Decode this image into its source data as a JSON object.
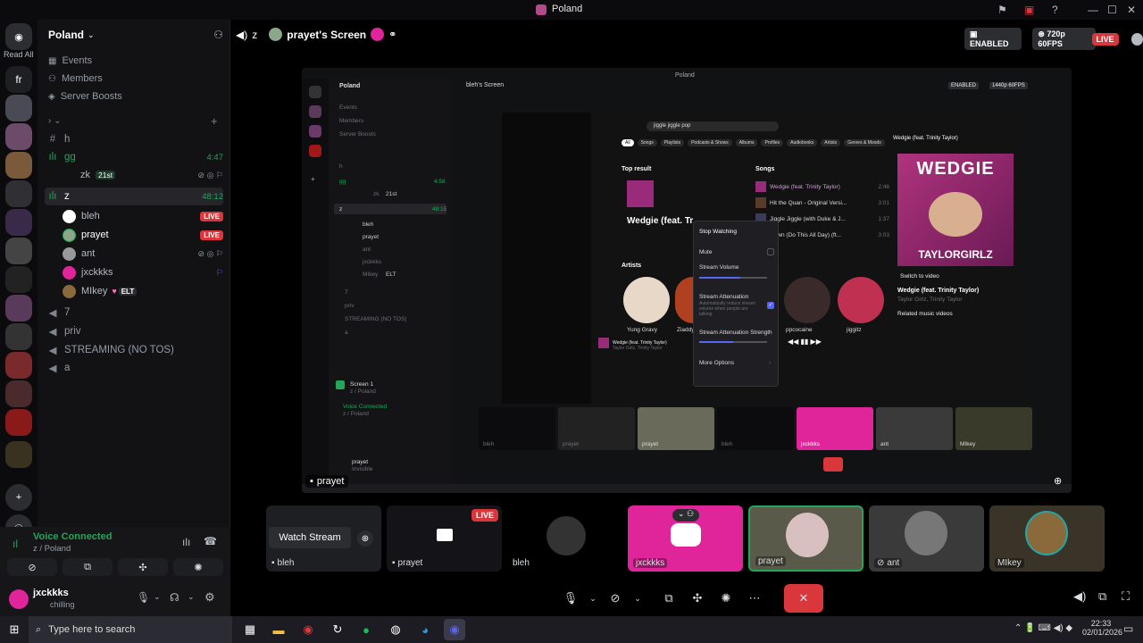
{
  "window": {
    "title": "Poland"
  },
  "rail": {
    "read_all": "Read All",
    "fr": "fr"
  },
  "server": {
    "name": "Poland"
  },
  "channels": {
    "nav": [
      "Events",
      "Members",
      "Server Boosts"
    ],
    "h": "h",
    "gg": {
      "name": "gg",
      "time": "4:47",
      "user": "zk",
      "badge": "21st"
    },
    "z": {
      "name": "z",
      "time": "48:12",
      "users": [
        {
          "name": "bleh",
          "live": "LIVE"
        },
        {
          "name": "prayet",
          "live": "LIVE"
        },
        {
          "name": "ant",
          "live": ""
        },
        {
          "name": "jxckkks",
          "live": ""
        },
        {
          "name": "MIkey",
          "tag": "ELT",
          "live": ""
        }
      ]
    },
    "others": [
      "7",
      "priv",
      "STREAMING (NO TOS)",
      "a"
    ]
  },
  "voice": {
    "status": "Voice Connected",
    "sub": "z / Poland"
  },
  "me": {
    "name": "jxckkks",
    "status": "chilling"
  },
  "topbar": {
    "channel": "z",
    "screen_title": "prayet's Screen",
    "enabled": "ENABLED",
    "quality": "720p 60FPS",
    "live": "LIVE"
  },
  "inner": {
    "title": "Poland",
    "server": "Poland",
    "screen": "bleh's Screen",
    "enabled": "ENABLED",
    "quality": "1440p 60FPS",
    "nav": [
      "Events",
      "Members",
      "Server Boosts"
    ],
    "channels": [
      "h",
      "gg",
      "z"
    ],
    "gg_time": "4:58",
    "gg_user": "zk",
    "gg_badge": "21st",
    "z_time": "48:15",
    "users": [
      "bleh",
      "prayet",
      "ant",
      "jxckkks",
      "MIkey"
    ],
    "tag": "ELT",
    "others": [
      "7",
      "priv",
      "STREAMING (NO TOS)",
      "a"
    ],
    "screen_panel": "Screen 1",
    "screen_panel_sub": "z / Poland",
    "voice": "Voice Connected",
    "voice_sub": "z / Poland",
    "me": "prayet",
    "me_status": "Invisible",
    "tiles": [
      "bleh",
      "prayet",
      "prayet",
      "bleh",
      "jxckkks",
      "ant",
      "MIkey"
    ]
  },
  "spotify": {
    "search": "jiggle jiggle pop",
    "filters": [
      "All",
      "Songs",
      "Playlists",
      "Podcasts & Shows",
      "Albums",
      "Profiles",
      "Audiobooks",
      "Artists",
      "Genres & Moods"
    ],
    "top_result": "Top result",
    "top_title": "Wedgie (feat. Tr",
    "songs_header": "Songs",
    "songs": [
      {
        "title": "Wedgie (feat. Trinity Taylor)",
        "time": "2:46"
      },
      {
        "title": "Hit the Quan - Original Versi...",
        "time": "3:01"
      },
      {
        "title": "Jiggle Jiggle (with Duke & J...",
        "time": "1:37"
      },
      {
        "title": "Down (Do This All Day) (ft...",
        "time": "3:03"
      }
    ],
    "artists_header": "Artists",
    "artists": [
      "Yung Gravy",
      "Ziaddyel",
      "ppcocaine",
      "jiggitz"
    ],
    "cover_top": "WEDGIE",
    "cover_bottom": "TAYLORGIRLZ",
    "np_title": "Wedgie (feat. Trinity Taylor)",
    "np_artists": "Taylor Girlz, Trinity Taylor",
    "switch": "Switch to video",
    "related": "Related music videos",
    "np_small": "Wedgie (feat. Trinity Taylor)",
    "np_small_sub": "Taylor Girlz, Trinity Taylor"
  },
  "context_menu": {
    "stop": "Stop Watching",
    "mute": "Mute",
    "volume": "Stream Volume",
    "atten": "Stream Attenuation",
    "atten_desc": "Automatically reduce stream volume when people are talking.",
    "atten_strength": "Stream Attenuation Strength",
    "more": "More Options",
    "volume_level": 0.6,
    "atten_level": 0.5
  },
  "stream_label": "prayet",
  "tiles": [
    {
      "name": "bleh",
      "action": "Watch Stream"
    },
    {
      "name": "prayet",
      "live": "LIVE"
    },
    {
      "name": "bleh"
    },
    {
      "name": "jxckkks"
    },
    {
      "name": "prayet"
    },
    {
      "name": "ant"
    },
    {
      "name": "MIkey"
    }
  ],
  "taskbar": {
    "search": "Type here to search",
    "time": "22:33",
    "date": "02/01/2026"
  },
  "colors": {
    "live": "#da373c",
    "discord": "#5865f2",
    "pink": "#e0249a",
    "green": "#23a55a",
    "bg": "#000000"
  }
}
